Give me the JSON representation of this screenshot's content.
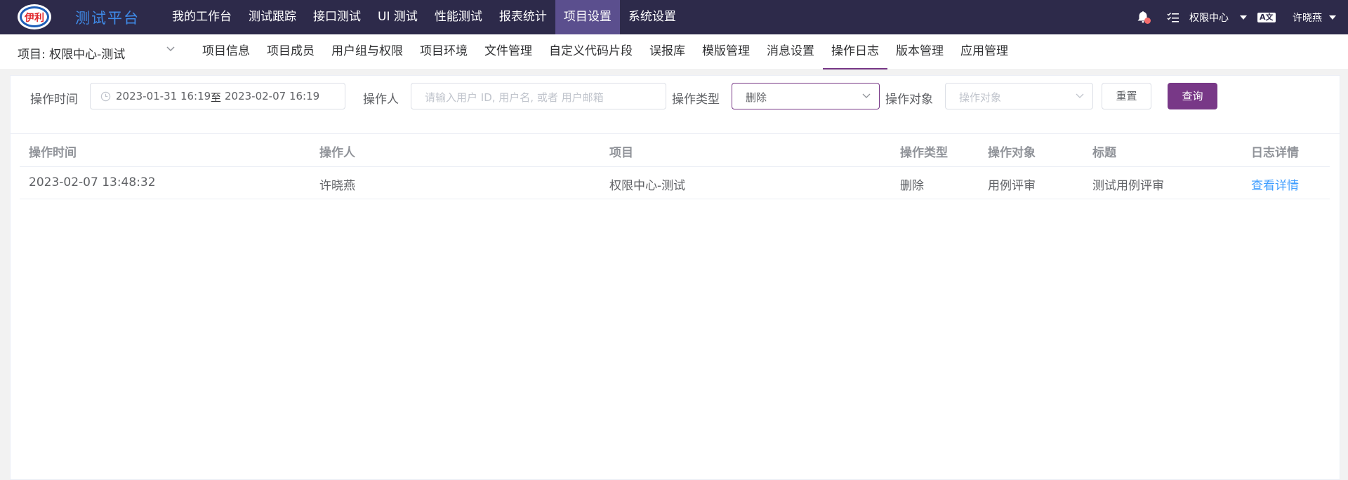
{
  "topbar": {
    "logo_text": "伊利",
    "brand": "测试平台",
    "nav": [
      "我的工作台",
      "测试跟踪",
      "接口测试",
      "UI 测试",
      "性能测试",
      "报表统计",
      "项目设置",
      "系统设置"
    ],
    "active_nav": "项目设置",
    "workspace": "权限中心",
    "user": "许晓燕",
    "lang_icon": "A文"
  },
  "subnav": {
    "project": "项目: 权限中心-测试",
    "tabs": [
      "项目信息",
      "项目成员",
      "用户组与权限",
      "项目环境",
      "文件管理",
      "自定义代码片段",
      "误报库",
      "模版管理",
      "消息设置",
      "操作日志",
      "版本管理",
      "应用管理"
    ],
    "active_tab": "操作日志"
  },
  "filter": {
    "time_label": "操作时间",
    "time_start": "2023-01-31 16:19",
    "time_sep": "至",
    "time_end": "2023-02-07 16:19",
    "operator_label": "操作人",
    "operator_placeholder": "请输入用户 ID, 用户名, 或者 用户邮箱",
    "type_label": "操作类型",
    "type_value": "删除",
    "object_label": "操作对象",
    "object_placeholder": "操作对象",
    "reset_button": "重置",
    "query_button": "查询"
  },
  "table": {
    "headers": [
      "操作时间",
      "操作人",
      "项目",
      "操作类型",
      "操作对象",
      "标题",
      "日志详情"
    ],
    "rows": [
      [
        "2023-02-07 13:48:32",
        "许晓燕",
        "权限中心-测试",
        "删除",
        "用例评审",
        "测试用例评审",
        "查看详情"
      ]
    ]
  },
  "colors": {
    "topbar_bg": "#2d2a4a",
    "active_nav_bg": "#5b4f8e",
    "accent": "#783887",
    "link": "#409eff",
    "badge": "#f56c6c"
  }
}
